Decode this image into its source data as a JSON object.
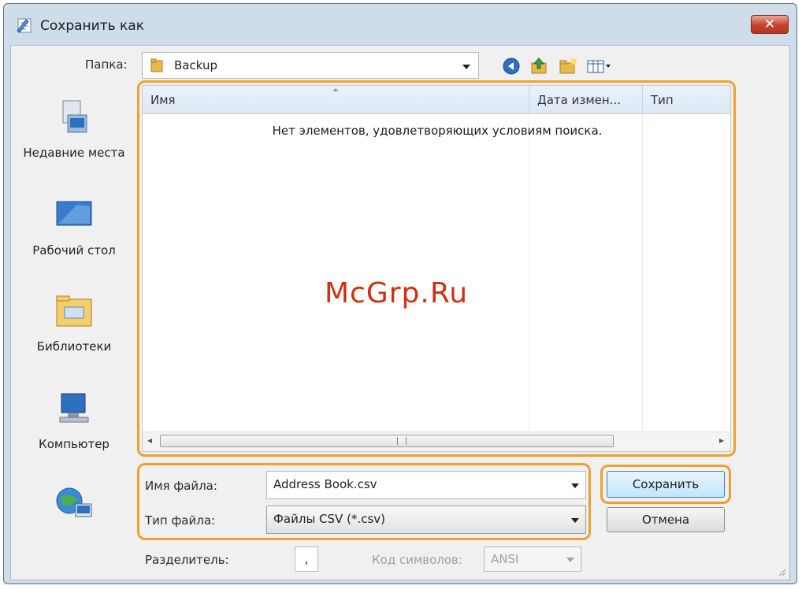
{
  "window": {
    "title": "Сохранить как",
    "close_label": "✕"
  },
  "toolbar": {
    "folder_label": "Папка:",
    "folder_value": "Backup",
    "icons": [
      "back-icon",
      "up-folder-icon",
      "new-folder-icon",
      "view-menu-icon"
    ]
  },
  "places": [
    {
      "label": "Недавние места",
      "icon": "recent-places-icon"
    },
    {
      "label": "Рабочий стол",
      "icon": "desktop-icon"
    },
    {
      "label": "Библиотеки",
      "icon": "libraries-icon"
    },
    {
      "label": "Компьютер",
      "icon": "computer-icon"
    },
    {
      "label": "",
      "icon": "network-icon"
    }
  ],
  "file_list": {
    "columns": [
      "Имя",
      "Дата измен...",
      "Тип"
    ],
    "empty_message": "Нет элементов, удовлетворяющих условиям поиска.",
    "scroll_left": "◂",
    "scroll_right": "▸"
  },
  "form": {
    "filename_label": "Имя файла:",
    "filename_value": "Address Book.csv",
    "filetype_label": "Тип файла:",
    "filetype_value": "Файлы CSV (*.csv)",
    "separator_label": "Разделитель:",
    "separator_value": ",",
    "encoding_label": "Код символов:",
    "encoding_value": "ANSI"
  },
  "buttons": {
    "save": "Сохранить",
    "cancel": "Отмена"
  },
  "watermark": "McGrp.Ru",
  "colors": {
    "highlight": "#f0a030",
    "titlebar": "#cfdcea",
    "close": "#c7432b"
  }
}
